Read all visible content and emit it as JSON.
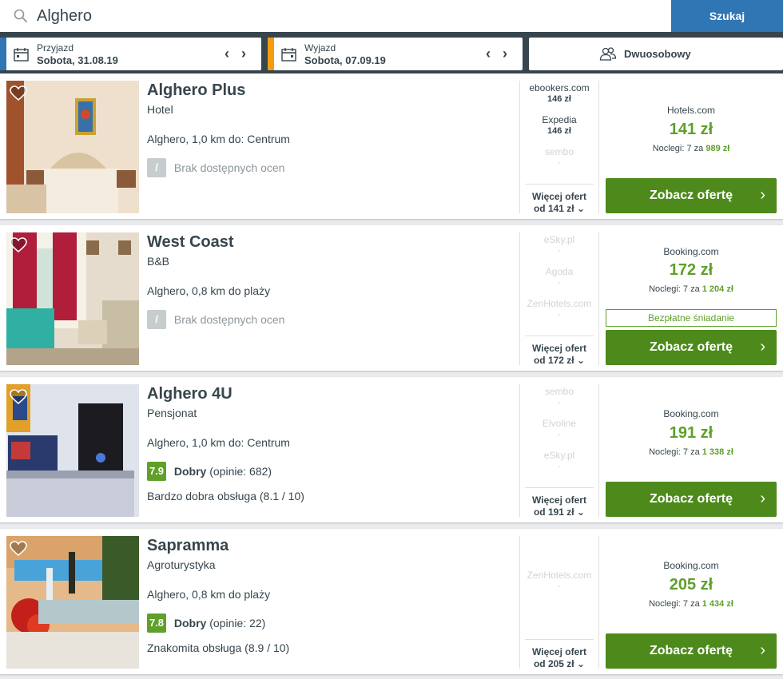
{
  "search": {
    "value": "Alghero",
    "button": "Szukaj"
  },
  "filters": {
    "checkin": {
      "label": "Przyjazd",
      "value": "Sobota, 31.08.19"
    },
    "checkout": {
      "label": "Wyjazd",
      "value": "Sobota, 07.09.19"
    },
    "room": {
      "value": "Dwuosobowy"
    },
    "arrow_prev": "‹",
    "arrow_next": "›"
  },
  "colors": {
    "checkin_accent": "#3075b4",
    "checkout_accent": "#f39c12",
    "deal_green": "#4d8a1b",
    "price_green": "#5f9f2a"
  },
  "results": [
    {
      "name": "Alghero Plus",
      "type": "Hotel",
      "location": "Alghero, 1,0 km do: Centrum",
      "rating": {
        "badge": "/",
        "label": "Brak dostępnych ocen"
      },
      "offers": [
        {
          "site": "ebookers.com",
          "price": "146 zł"
        },
        {
          "site": "Expedia",
          "price": "146 zł"
        },
        {
          "site": "sembo",
          "price": "-"
        }
      ],
      "more": {
        "line1": "Więcej ofert",
        "line2": "od 141 zł"
      },
      "best": {
        "provider": "Hotels.com",
        "price": "141 zł",
        "nights_prefix": "Noclegi: 7 za",
        "nights_total": "989 zł"
      },
      "button": "Zobacz ofertę"
    },
    {
      "name": "West Coast",
      "type": "B&B",
      "location": "Alghero, 0,8 km do plaży",
      "rating": {
        "badge": "/",
        "label": "Brak dostępnych ocen"
      },
      "offers": [
        {
          "site": "eSky.pl",
          "price": "-"
        },
        {
          "site": "Agoda",
          "price": "-"
        },
        {
          "site": "ZenHotels.com",
          "price": "-"
        }
      ],
      "more": {
        "line1": "Więcej ofert",
        "line2": "od 172 zł"
      },
      "best": {
        "provider": "Booking.com",
        "price": "172 zł",
        "nights_prefix": "Noclegi: 7 za",
        "nights_total": "1 204 zł",
        "perk": "Bezpłatne śniadanie"
      },
      "button": "Zobacz ofertę"
    },
    {
      "name": "Alghero 4U",
      "type": "Pensjonat",
      "location": "Alghero, 1,0 km do: Centrum",
      "rating": {
        "badge": "7.9",
        "word": "Dobry",
        "count": "(opinie: 682)"
      },
      "service": "Bardzo dobra obsługa (8.1 / 10)",
      "offers": [
        {
          "site": "sembo",
          "price": "-"
        },
        {
          "site": "Elvoline",
          "price": "-"
        },
        {
          "site": "eSky.pl",
          "price": "-"
        }
      ],
      "more": {
        "line1": "Więcej ofert",
        "line2": "od 191 zł"
      },
      "best": {
        "provider": "Booking.com",
        "price": "191 zł",
        "nights_prefix": "Noclegi: 7 za",
        "nights_total": "1 338 zł"
      },
      "button": "Zobacz ofertę"
    },
    {
      "name": "Sapramma",
      "type": "Agroturystyka",
      "location": "Alghero, 0,8 km do plaży",
      "rating": {
        "badge": "7.8",
        "word": "Dobry",
        "count": "(opinie: 22)"
      },
      "service": "Znakomita obsługa (8.9 / 10)",
      "offers": [
        {
          "site": "ZenHotels.com",
          "price": "-"
        }
      ],
      "more": {
        "line1": "Więcej ofert",
        "line2": "od 205 zł"
      },
      "best": {
        "provider": "Booking.com",
        "price": "205 zł",
        "nights_prefix": "Noclegi: 7 za",
        "nights_total": "1 434 zł"
      },
      "button": "Zobacz ofertę"
    }
  ]
}
